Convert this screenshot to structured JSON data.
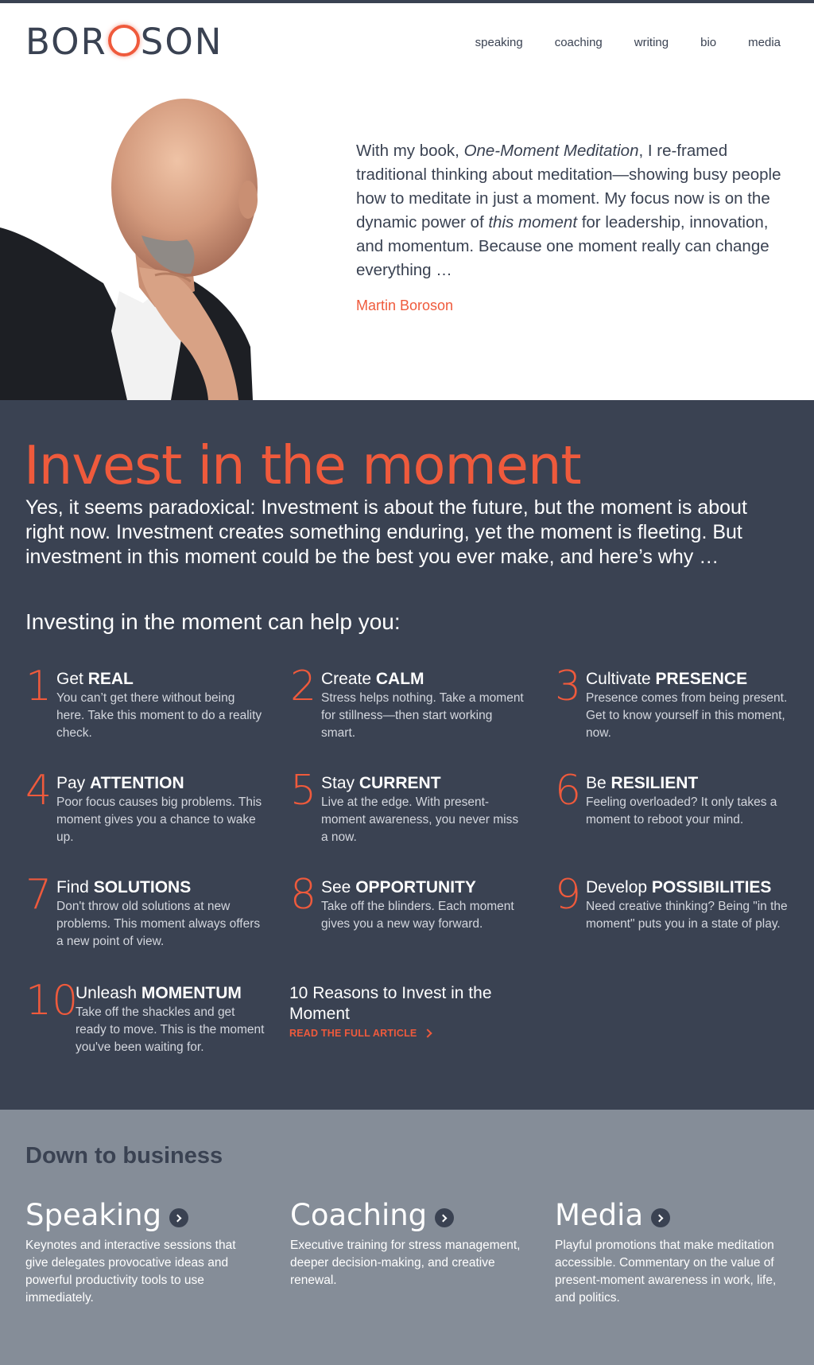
{
  "header": {
    "logo": {
      "before": "BOR",
      "after": "SON"
    },
    "nav": [
      "speaking",
      "coaching",
      "writing",
      "bio",
      "media"
    ]
  },
  "hero": {
    "quote": {
      "p1": "With my book, ",
      "book": "One-Moment Meditation",
      "p2": ", I re-framed traditional thinking about meditation—showing busy people how to meditate in just a moment. My focus now is on the dynamic power of ",
      "em2": "this moment",
      "p3": " for leadership, innovation, and momentum. Because one moment really can change everything …"
    },
    "author": "Martin Boroson"
  },
  "invest": {
    "title": "Invest in the moment",
    "intro": "Yes, it seems paradoxical: Investment is about the future, but the moment is about right now. Investment creates something enduring, yet the moment is fleeting. But investment in this moment could be the best you ever make, and here’s why …",
    "help_title": "Investing in the moment can help you:",
    "reasons": [
      {
        "num": "1",
        "verb": "Get",
        "key": "REAL",
        "text": "You can’t get there without being here. Take this moment to do a reality check."
      },
      {
        "num": "2",
        "verb": "Create",
        "key": "CALM",
        "text": "Stress helps nothing. Take a moment for stillness—then start working smart."
      },
      {
        "num": "3",
        "verb": "Cultivate",
        "key": "PRESENCE",
        "text": "Presence comes from being present. Get to know yourself in this moment, now."
      },
      {
        "num": "4",
        "verb": "Pay",
        "key": "ATTENTION",
        "text": "Poor focus causes big problems. This moment gives you a chance to wake up."
      },
      {
        "num": "5",
        "verb": "Stay",
        "key": "CURRENT",
        "text": "Live at the edge. With present-moment awareness, you never miss a now."
      },
      {
        "num": "6",
        "verb": "Be",
        "key": "RESILIENT",
        "text": "Feeling overloaded? It only takes a moment to reboot your mind."
      },
      {
        "num": "7",
        "verb": "Find",
        "key": "SOLUTIONS",
        "text": "Don't throw old solutions at new problems. This moment always offers a new point of view."
      },
      {
        "num": "8",
        "verb": "See",
        "key": "OPPORTUNITY",
        "text": "Take off the blinders. Each moment gives you a new way forward."
      },
      {
        "num": "9",
        "verb": "Develop",
        "key": "POSSIBILITIES",
        "text": "Need creative thinking? Being \"in the moment\" puts you in a state of play."
      },
      {
        "num": "10",
        "verb": "Unleash",
        "key": "MOMENTUM",
        "text": "Take off the shackles and get ready to move. This is the moment you've been waiting for."
      }
    ],
    "article_title": "10 Reasons to Invest in the Moment",
    "article_link": "READ THE FULL ARTICLE"
  },
  "business": {
    "title": "Down to business",
    "items": [
      {
        "title": "Speaking",
        "text": "Keynotes and interactive sessions that give delegates provocative ideas and powerful productivity tools to use immediately."
      },
      {
        "title": "Coaching",
        "text": "Executive training for stress management, deeper decision-making, and creative renewal."
      },
      {
        "title": "Media",
        "text": "Playful promotions that make meditation accessible. Commentary on the value of present-moment awareness in work, life, and politics."
      }
    ]
  },
  "colors": {
    "accent": "#ef5a3c",
    "dark": "#3a4252",
    "grey": "#858d98"
  }
}
